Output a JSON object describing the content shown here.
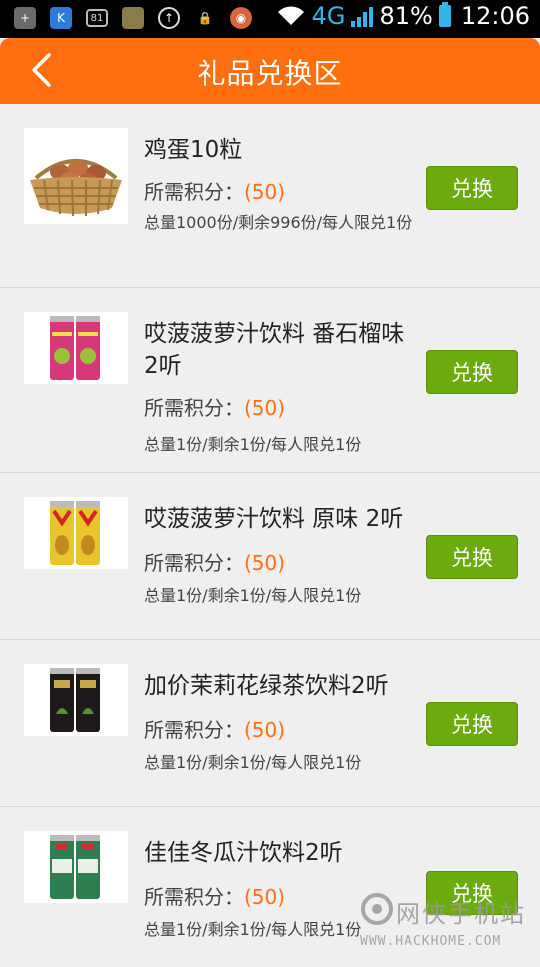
{
  "status_bar": {
    "notif_num": "81",
    "network": "4G",
    "battery": "81%",
    "time": "12:06"
  },
  "header": {
    "title": "礼品兑换区"
  },
  "labels": {
    "points_prefix": "所需积分：",
    "exchange": "兑换"
  },
  "items": [
    {
      "name": "鸡蛋10粒",
      "points": "(50)",
      "quantity": "总量1000份/剩余996份/每人限兑1份",
      "image": "eggs-basket"
    },
    {
      "name": "哎菠菠萝汁饮料 番石榴味 2听",
      "points": "(50)",
      "quantity": "总量1份/剩余1份/每人限兑1份",
      "image": "guava-cans"
    },
    {
      "name": "哎菠菠萝汁饮料 原味 2听",
      "points": "(50)",
      "quantity": "总量1份/剩余1份/每人限兑1份",
      "image": "pineapple-cans"
    },
    {
      "name": "加价茉莉花绿茶饮料2听",
      "points": "(50)",
      "quantity": "总量1份/剩余1份/每人限兑1份",
      "image": "green-tea-cans"
    },
    {
      "name": "佳佳冬瓜汁饮料2听",
      "points": "(50)",
      "quantity": "总量1份/剩余1份/每人限兑1份",
      "image": "winter-melon-cans"
    }
  ],
  "watermark": {
    "text": "网侠手机站",
    "url": "WWW.HACKHOME.COM"
  },
  "colors": {
    "accent": "#ff6f10",
    "button": "#6bab0e"
  }
}
